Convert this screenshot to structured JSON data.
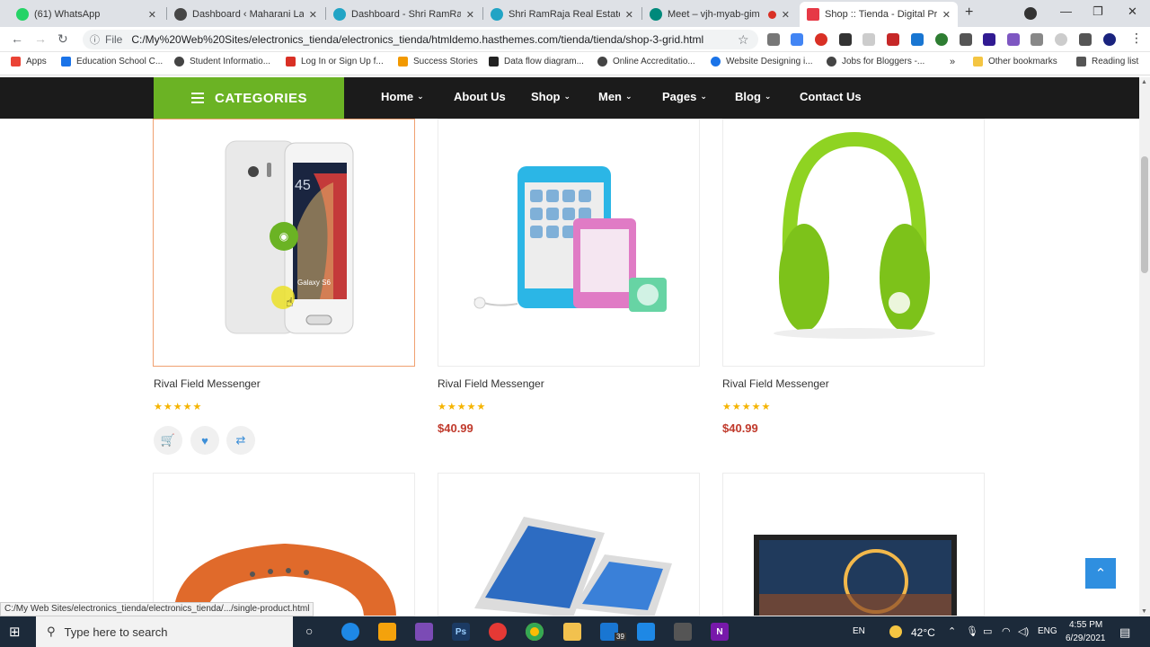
{
  "browser": {
    "tabs": [
      {
        "label": "(61) WhatsApp",
        "color": "#25d366"
      },
      {
        "label": "Dashboard ‹ Maharani Laxmi",
        "color": "#464646"
      },
      {
        "label": "Dashboard - Shri RamRaja R",
        "color": "#21a4c5"
      },
      {
        "label": "Shri RamRaja Real Estate",
        "color": "#21a4c5"
      },
      {
        "label": "Meet – vjh-myab-gim",
        "color": "#00897b"
      },
      {
        "label": "Shop :: Tienda - Digital Pro",
        "color": "#e63946"
      }
    ],
    "new_tab": "+",
    "window_controls": {
      "minimize": "—",
      "maximize": "❐",
      "close": "✕"
    },
    "address": {
      "file_label": "File",
      "url": "C:/My%20Web%20Sites/electronics_tienda/electronics_tienda/htmldemo.hasthemes.com/tienda/tienda/shop-3-grid.html"
    },
    "bookmarks": [
      {
        "label": "Apps",
        "color": "#ea4335"
      },
      {
        "label": "Education School C...",
        "color": "#1a73e8"
      },
      {
        "label": "Student Informatio...",
        "color": "#444444"
      },
      {
        "label": "Log In or Sign Up f...",
        "color": "#d93025"
      },
      {
        "label": "Success Stories",
        "color": "#f29900"
      },
      {
        "label": "Data flow diagram...",
        "color": "#222222"
      },
      {
        "label": "Online Accreditatio...",
        "color": "#444444"
      },
      {
        "label": "Website Designing i...",
        "color": "#1a73e8"
      },
      {
        "label": "Jobs for Bloggers -...",
        "color": "#444444"
      }
    ],
    "bookmarks_more": "»",
    "other_bookmarks": "Other bookmarks",
    "reading_list": "Reading list",
    "status_url": "C:/My Web Sites/electronics_tienda/electronics_tienda/.../single-product.html"
  },
  "site": {
    "categories_label": "CATEGORIES",
    "menu": [
      {
        "label": "Home",
        "dropdown": true
      },
      {
        "label": "About Us",
        "dropdown": false
      },
      {
        "label": "Shop",
        "dropdown": true
      },
      {
        "label": "Men",
        "dropdown": true
      },
      {
        "label": "Pages",
        "dropdown": true
      },
      {
        "label": "Blog",
        "dropdown": true
      },
      {
        "label": "Contact Us",
        "dropdown": false
      }
    ],
    "products": [
      {
        "title": "Rival Field Messenger",
        "rating": 5,
        "price": "",
        "image": "smartphone"
      },
      {
        "title": "Rival Field Messenger",
        "rating": 5,
        "price": "$40.99",
        "image": "mp3-player"
      },
      {
        "title": "Rival Field Messenger",
        "rating": 5,
        "price": "$40.99",
        "image": "headphones"
      }
    ],
    "phone_screen_text": "Galaxy S6",
    "phone_clock_text": "45",
    "colors": {
      "accent_green": "#6bb324",
      "price_red": "#c0392b",
      "star": "#f5b400",
      "nav_bg": "#1b1b1b"
    }
  },
  "taskbar": {
    "search_placeholder": "Type here to search",
    "language": "EN",
    "weather": "42°C",
    "input_lang": "ENG",
    "time": "4:55 PM",
    "date": "6/29/2021",
    "mail_badge": "39"
  }
}
